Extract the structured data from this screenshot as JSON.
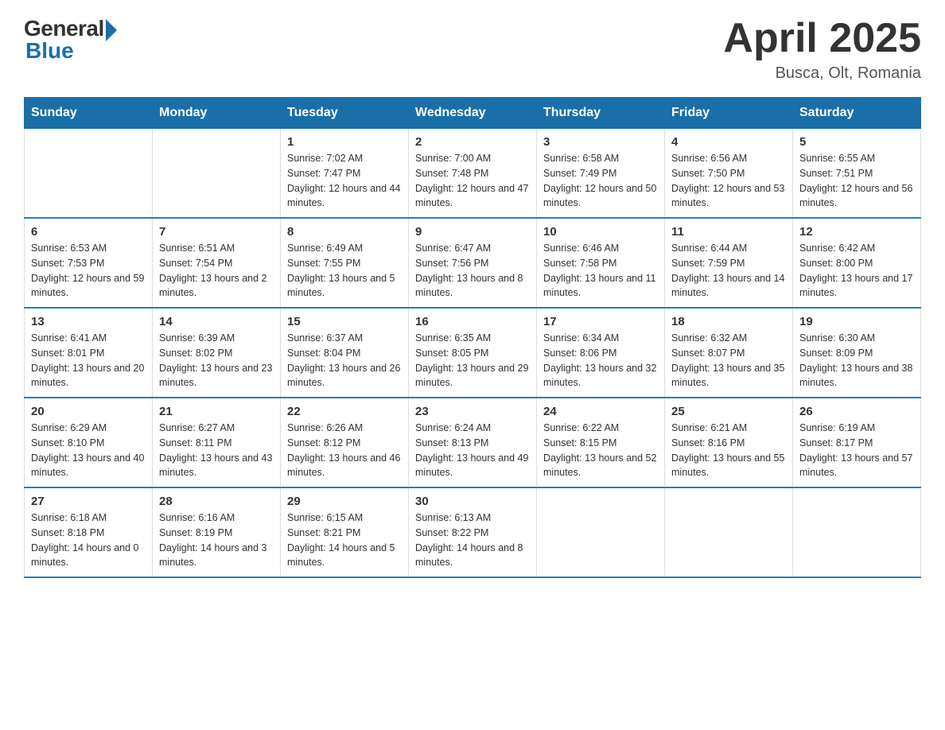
{
  "logo": {
    "general": "General",
    "blue": "Blue"
  },
  "title": "April 2025",
  "subtitle": "Busca, Olt, Romania",
  "days_header": [
    "Sunday",
    "Monday",
    "Tuesday",
    "Wednesday",
    "Thursday",
    "Friday",
    "Saturday"
  ],
  "weeks": [
    [
      {
        "day": "",
        "sunrise": "",
        "sunset": "",
        "daylight": ""
      },
      {
        "day": "",
        "sunrise": "",
        "sunset": "",
        "daylight": ""
      },
      {
        "day": "1",
        "sunrise": "Sunrise: 7:02 AM",
        "sunset": "Sunset: 7:47 PM",
        "daylight": "Daylight: 12 hours and 44 minutes."
      },
      {
        "day": "2",
        "sunrise": "Sunrise: 7:00 AM",
        "sunset": "Sunset: 7:48 PM",
        "daylight": "Daylight: 12 hours and 47 minutes."
      },
      {
        "day": "3",
        "sunrise": "Sunrise: 6:58 AM",
        "sunset": "Sunset: 7:49 PM",
        "daylight": "Daylight: 12 hours and 50 minutes."
      },
      {
        "day": "4",
        "sunrise": "Sunrise: 6:56 AM",
        "sunset": "Sunset: 7:50 PM",
        "daylight": "Daylight: 12 hours and 53 minutes."
      },
      {
        "day": "5",
        "sunrise": "Sunrise: 6:55 AM",
        "sunset": "Sunset: 7:51 PM",
        "daylight": "Daylight: 12 hours and 56 minutes."
      }
    ],
    [
      {
        "day": "6",
        "sunrise": "Sunrise: 6:53 AM",
        "sunset": "Sunset: 7:53 PM",
        "daylight": "Daylight: 12 hours and 59 minutes."
      },
      {
        "day": "7",
        "sunrise": "Sunrise: 6:51 AM",
        "sunset": "Sunset: 7:54 PM",
        "daylight": "Daylight: 13 hours and 2 minutes."
      },
      {
        "day": "8",
        "sunrise": "Sunrise: 6:49 AM",
        "sunset": "Sunset: 7:55 PM",
        "daylight": "Daylight: 13 hours and 5 minutes."
      },
      {
        "day": "9",
        "sunrise": "Sunrise: 6:47 AM",
        "sunset": "Sunset: 7:56 PM",
        "daylight": "Daylight: 13 hours and 8 minutes."
      },
      {
        "day": "10",
        "sunrise": "Sunrise: 6:46 AM",
        "sunset": "Sunset: 7:58 PM",
        "daylight": "Daylight: 13 hours and 11 minutes."
      },
      {
        "day": "11",
        "sunrise": "Sunrise: 6:44 AM",
        "sunset": "Sunset: 7:59 PM",
        "daylight": "Daylight: 13 hours and 14 minutes."
      },
      {
        "day": "12",
        "sunrise": "Sunrise: 6:42 AM",
        "sunset": "Sunset: 8:00 PM",
        "daylight": "Daylight: 13 hours and 17 minutes."
      }
    ],
    [
      {
        "day": "13",
        "sunrise": "Sunrise: 6:41 AM",
        "sunset": "Sunset: 8:01 PM",
        "daylight": "Daylight: 13 hours and 20 minutes."
      },
      {
        "day": "14",
        "sunrise": "Sunrise: 6:39 AM",
        "sunset": "Sunset: 8:02 PM",
        "daylight": "Daylight: 13 hours and 23 minutes."
      },
      {
        "day": "15",
        "sunrise": "Sunrise: 6:37 AM",
        "sunset": "Sunset: 8:04 PM",
        "daylight": "Daylight: 13 hours and 26 minutes."
      },
      {
        "day": "16",
        "sunrise": "Sunrise: 6:35 AM",
        "sunset": "Sunset: 8:05 PM",
        "daylight": "Daylight: 13 hours and 29 minutes."
      },
      {
        "day": "17",
        "sunrise": "Sunrise: 6:34 AM",
        "sunset": "Sunset: 8:06 PM",
        "daylight": "Daylight: 13 hours and 32 minutes."
      },
      {
        "day": "18",
        "sunrise": "Sunrise: 6:32 AM",
        "sunset": "Sunset: 8:07 PM",
        "daylight": "Daylight: 13 hours and 35 minutes."
      },
      {
        "day": "19",
        "sunrise": "Sunrise: 6:30 AM",
        "sunset": "Sunset: 8:09 PM",
        "daylight": "Daylight: 13 hours and 38 minutes."
      }
    ],
    [
      {
        "day": "20",
        "sunrise": "Sunrise: 6:29 AM",
        "sunset": "Sunset: 8:10 PM",
        "daylight": "Daylight: 13 hours and 40 minutes."
      },
      {
        "day": "21",
        "sunrise": "Sunrise: 6:27 AM",
        "sunset": "Sunset: 8:11 PM",
        "daylight": "Daylight: 13 hours and 43 minutes."
      },
      {
        "day": "22",
        "sunrise": "Sunrise: 6:26 AM",
        "sunset": "Sunset: 8:12 PM",
        "daylight": "Daylight: 13 hours and 46 minutes."
      },
      {
        "day": "23",
        "sunrise": "Sunrise: 6:24 AM",
        "sunset": "Sunset: 8:13 PM",
        "daylight": "Daylight: 13 hours and 49 minutes."
      },
      {
        "day": "24",
        "sunrise": "Sunrise: 6:22 AM",
        "sunset": "Sunset: 8:15 PM",
        "daylight": "Daylight: 13 hours and 52 minutes."
      },
      {
        "day": "25",
        "sunrise": "Sunrise: 6:21 AM",
        "sunset": "Sunset: 8:16 PM",
        "daylight": "Daylight: 13 hours and 55 minutes."
      },
      {
        "day": "26",
        "sunrise": "Sunrise: 6:19 AM",
        "sunset": "Sunset: 8:17 PM",
        "daylight": "Daylight: 13 hours and 57 minutes."
      }
    ],
    [
      {
        "day": "27",
        "sunrise": "Sunrise: 6:18 AM",
        "sunset": "Sunset: 8:18 PM",
        "daylight": "Daylight: 14 hours and 0 minutes."
      },
      {
        "day": "28",
        "sunrise": "Sunrise: 6:16 AM",
        "sunset": "Sunset: 8:19 PM",
        "daylight": "Daylight: 14 hours and 3 minutes."
      },
      {
        "day": "29",
        "sunrise": "Sunrise: 6:15 AM",
        "sunset": "Sunset: 8:21 PM",
        "daylight": "Daylight: 14 hours and 5 minutes."
      },
      {
        "day": "30",
        "sunrise": "Sunrise: 6:13 AM",
        "sunset": "Sunset: 8:22 PM",
        "daylight": "Daylight: 14 hours and 8 minutes."
      },
      {
        "day": "",
        "sunrise": "",
        "sunset": "",
        "daylight": ""
      },
      {
        "day": "",
        "sunrise": "",
        "sunset": "",
        "daylight": ""
      },
      {
        "day": "",
        "sunrise": "",
        "sunset": "",
        "daylight": ""
      }
    ]
  ]
}
